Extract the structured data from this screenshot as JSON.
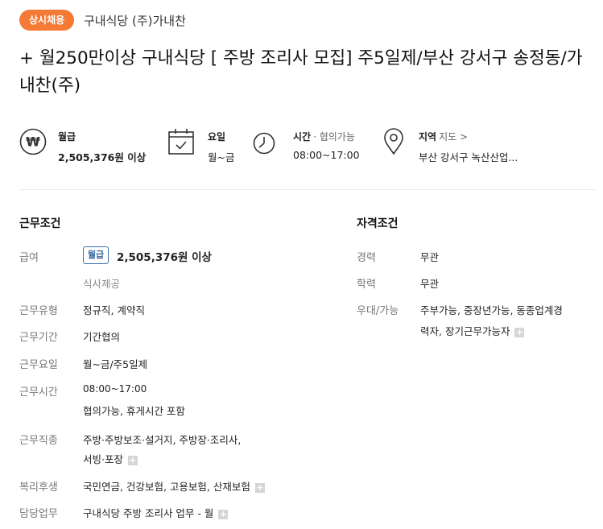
{
  "header": {
    "badge": "상시채용",
    "company": "구내식당 (주)가내찬",
    "title": "+ 월250만이상 구내식당 [ 주방 조리사 모집] 주5일제/부산 강서구 송정동/가내찬(주)"
  },
  "summary": [
    {
      "icon": "won-icon",
      "label": "월급",
      "sub": "",
      "value": "2,505,376원 이상"
    },
    {
      "icon": "calendar-icon",
      "label": "요일",
      "sub": "",
      "value": "월~금"
    },
    {
      "icon": "clock-icon",
      "label": "시간",
      "sub": "· 협의가능",
      "value": "08:00~17:00"
    },
    {
      "icon": "location-pin-icon",
      "label": "지역",
      "sub": "지도 >",
      "value": "부산 강서구 녹산산업..."
    }
  ],
  "work": {
    "title": "근무조건",
    "salary_label": "급여",
    "salary_tag": "월급",
    "salary_amount": "2,505,376원 이상",
    "meal": "식사제공",
    "type_label": "근무유형",
    "type_value": "정규직, 계약직",
    "period_label": "근무기간",
    "period_value": "기간협의",
    "days_label": "근무요일",
    "days_value": "월~금/주5일제",
    "hours_label": "근무시간",
    "hours_value": "08:00~17:00",
    "hours_note": "협의가능, 휴게시간 포함",
    "job_label": "근무직종",
    "job_value_1": "주방·주방보조·설거지, 주방장·조리사,",
    "job_value_2": "서빙·포장",
    "welfare_label": "복리후생",
    "welfare_value": "국민연금, 건강보험, 고용보험, 산재보험",
    "duty_label": "담당업무",
    "duty_value": "구내식당 주방 조리사 업무 - 월"
  },
  "qualify": {
    "title": "자격조건",
    "career_label": "경력",
    "career_value": "무관",
    "edu_label": "학력",
    "edu_value": "무관",
    "pref_label": "우대/가능",
    "pref_value_1": "주부가능, 중장년가능, 동종업계경",
    "pref_value_2": "력자, 장기근무가능자"
  },
  "plus_symbol": "+",
  "colors": {
    "accent": "#f47a35",
    "tag_blue": "#2f5f9e",
    "label_gray": "#777777"
  }
}
